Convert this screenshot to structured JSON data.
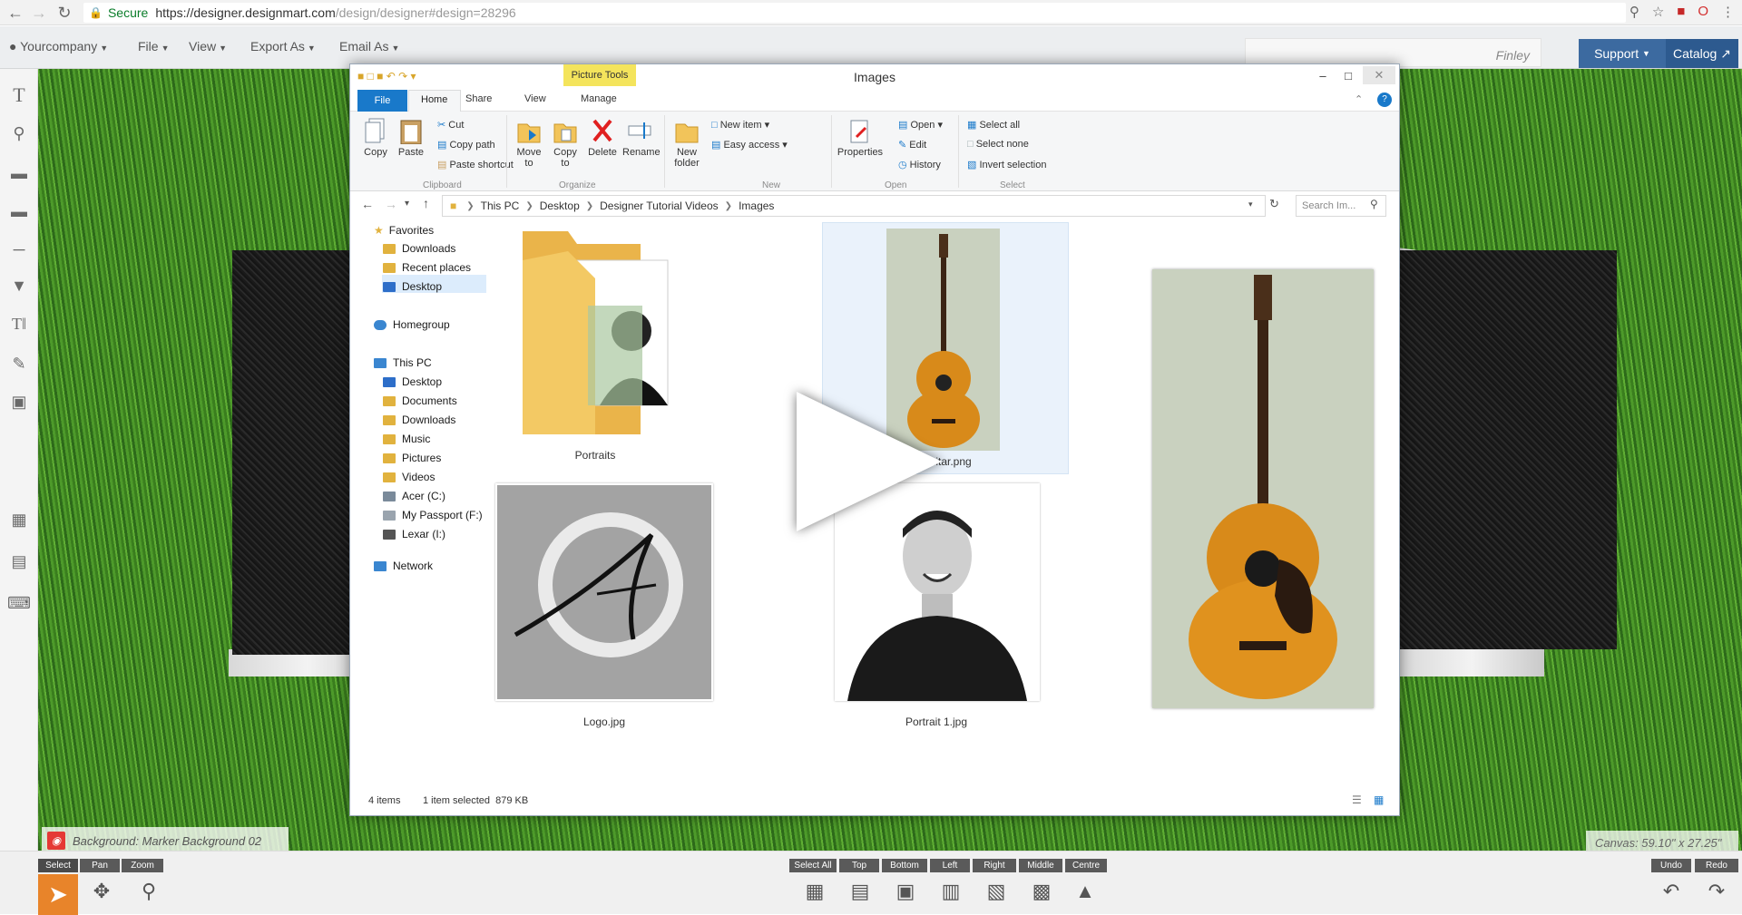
{
  "browser": {
    "secure_label": "Secure",
    "url_host": "https://designer.designmart.com",
    "url_path": "/design/designer#design=28296"
  },
  "appbar": {
    "company": "Yourcompany",
    "menus": [
      "File",
      "View",
      "Export As",
      "Email As"
    ],
    "user_name": "Finley",
    "support_label": "Support",
    "catalog_label": "Catalog"
  },
  "explorer": {
    "title": "Images",
    "picture_tools": "Picture Tools",
    "tabs": [
      "File",
      "Home",
      "Share",
      "View",
      "Manage"
    ],
    "ribbon": {
      "copy": "Copy",
      "paste": "Paste",
      "cut": "Cut",
      "copy_path": "Copy path",
      "paste_shortcut": "Paste shortcut",
      "move_to": "Move to",
      "copy_to": "Copy to",
      "delete": "Delete",
      "rename": "Rename",
      "new_folder": "New folder",
      "new_item": "New item",
      "easy_access": "Easy access",
      "properties": "Properties",
      "open": "Open",
      "edit": "Edit",
      "history": "History",
      "select_all": "Select all",
      "select_none": "Select none",
      "invert_selection": "Invert selection",
      "groups": [
        "Clipboard",
        "Organize",
        "New",
        "Open",
        "Select"
      ]
    },
    "breadcrumb": [
      "This PC",
      "Desktop",
      "Designer Tutorial Videos",
      "Images"
    ],
    "search_placeholder": "Search Im...",
    "nav": {
      "favorites": "Favorites",
      "fav_items": [
        "Downloads",
        "Recent places",
        "Desktop"
      ],
      "homegroup": "Homegroup",
      "this_pc": "This PC",
      "pc_items": [
        "Desktop",
        "Documents",
        "Downloads",
        "Music",
        "Pictures",
        "Videos",
        "Acer (C:)",
        "My Passport (F:)",
        "Lexar (I:)"
      ],
      "network": "Network"
    },
    "files": [
      {
        "name": "Portraits"
      },
      {
        "name": "Guitar.png"
      },
      {
        "name": "Logo.jpg"
      },
      {
        "name": "Portrait 1.jpg"
      }
    ],
    "status": {
      "items": "4 items",
      "selected": "1 item selected  879 KB"
    }
  },
  "canvas": {
    "background_label": "Background: Marker Background 02",
    "size_label": "Canvas: 59.10\" x 27.25\""
  },
  "bottom": {
    "mode_labels": [
      "Select",
      "Pan",
      "Zoom"
    ],
    "align_labels": [
      "Select All",
      "Top",
      "Bottom",
      "Left",
      "Right",
      "Middle",
      "Centre"
    ],
    "history_labels": [
      "Undo",
      "Redo"
    ]
  }
}
